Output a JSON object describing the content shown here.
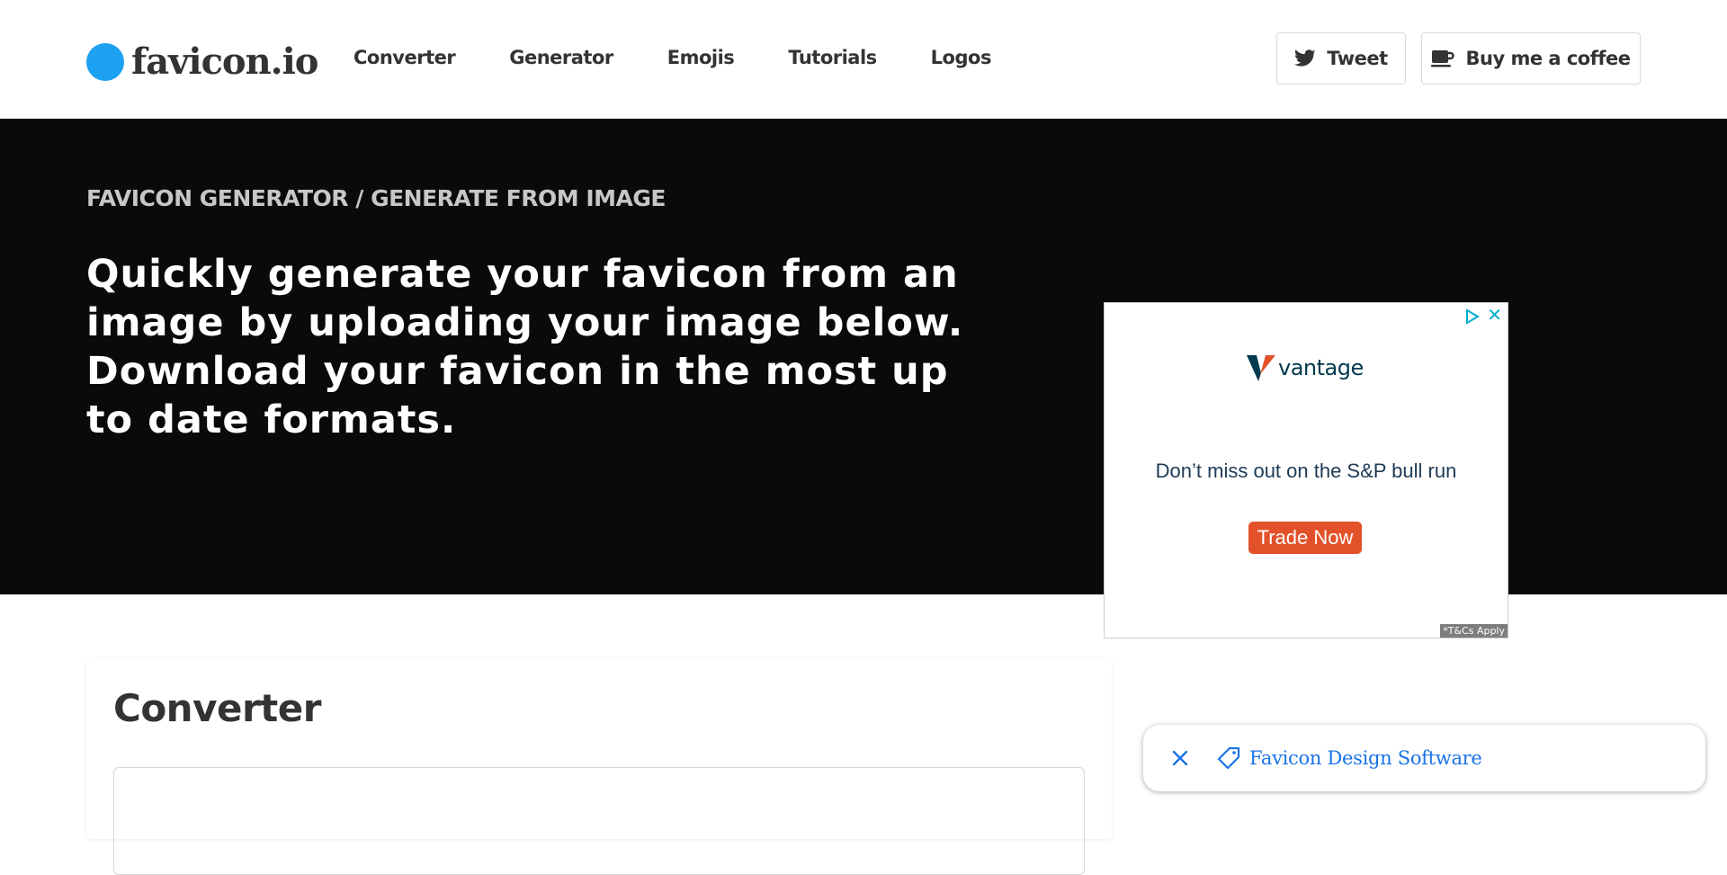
{
  "header": {
    "logo_text": "favicon.io",
    "nav": [
      {
        "label": "Converter"
      },
      {
        "label": "Generator"
      },
      {
        "label": "Emojis"
      },
      {
        "label": "Tutorials"
      },
      {
        "label": "Logos"
      }
    ],
    "tweet_label": "Tweet",
    "coffee_label": "Buy me a coffee"
  },
  "hero": {
    "breadcrumb": "FAVICON GENERATOR / GENERATE FROM IMAGE",
    "headline": "Quickly generate your favicon from an image by uploading your image below. Download your favicon in the most up to date formats."
  },
  "ad": {
    "brand": "vantage",
    "message": "Don’t miss out on the S&P bull run",
    "cta": "Trade Now",
    "terms": "*T&Cs Apply",
    "close_glyph": "✕"
  },
  "main": {
    "card_title": "Converter"
  },
  "suggestion": {
    "label": "Favicon Design Software"
  },
  "colors": {
    "accent": "#1da1f2",
    "hero_bg": "#0a0a0a",
    "ad_cta": "#e3512a",
    "link_blue": "#1a73e8"
  }
}
